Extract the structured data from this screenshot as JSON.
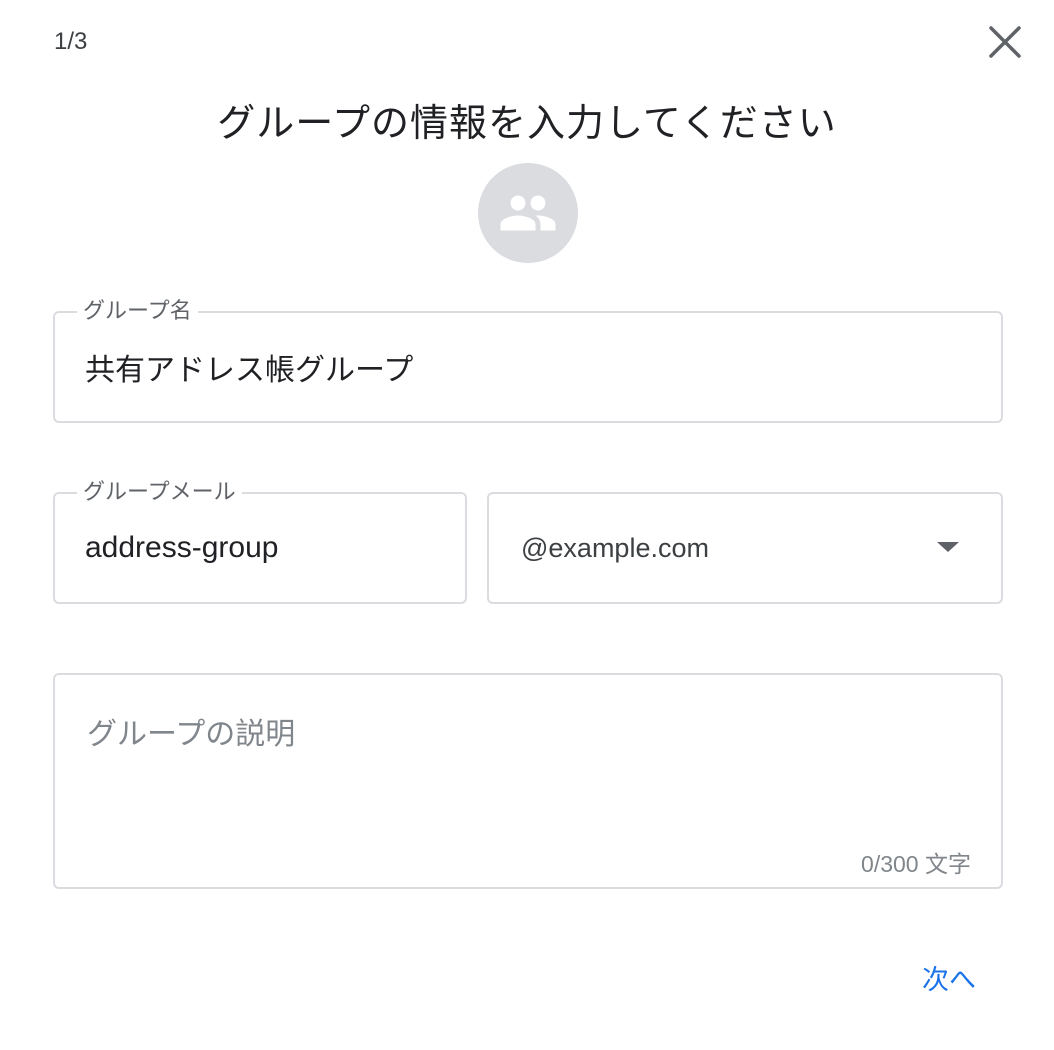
{
  "dialog": {
    "step": "1/3",
    "title": "グループの情報を入力してください",
    "avatar_icon": "group-icon"
  },
  "form": {
    "group_name": {
      "label": "グループ名",
      "value": "共有アドレス帳グループ"
    },
    "group_email": {
      "label": "グループメール",
      "value": "address-group"
    },
    "domain": {
      "selected": "@example.com"
    },
    "description": {
      "placeholder": "グループの説明",
      "counter": "0/300 文字"
    }
  },
  "actions": {
    "next_label": "次へ"
  },
  "colors": {
    "accent": "#1a73e8",
    "border": "#dadce0",
    "avatar_bg": "#dadce0"
  }
}
